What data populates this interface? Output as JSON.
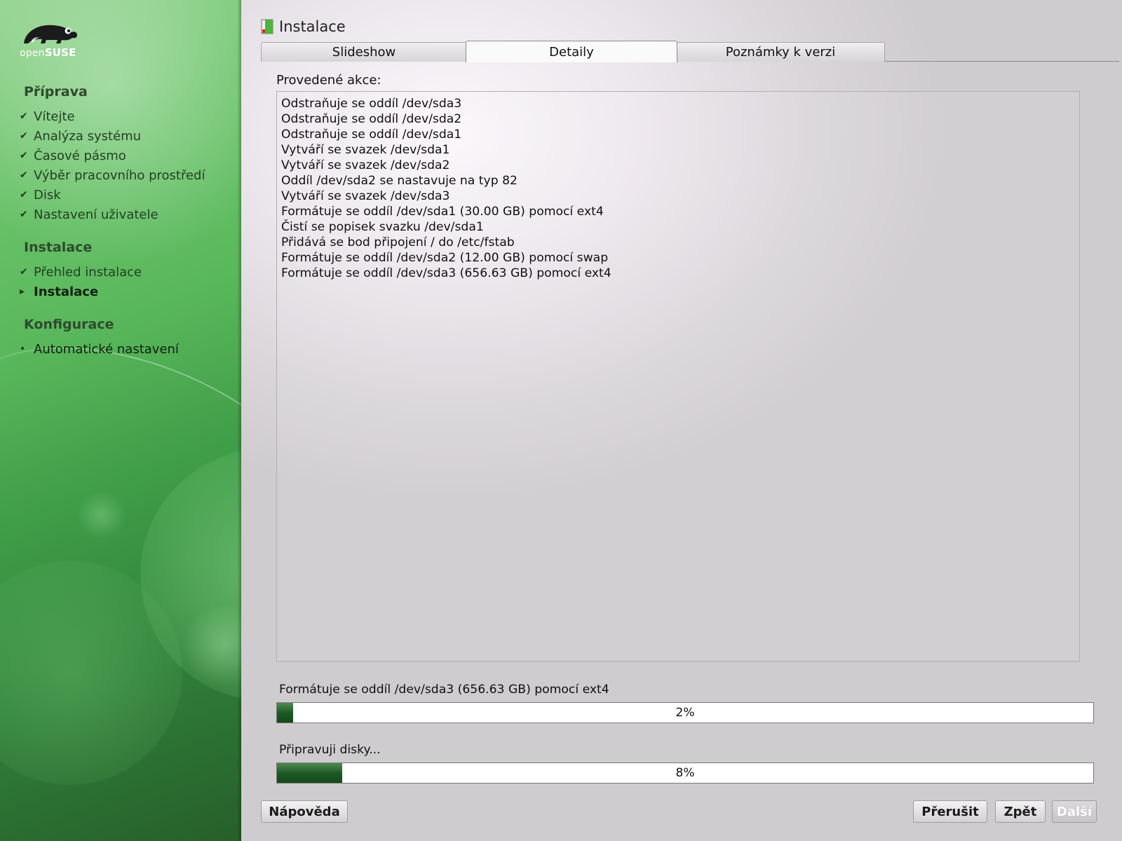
{
  "brand": {
    "logo_text_light": "open",
    "logo_text_bold": "SUSE",
    "accent": "#3f9c47"
  },
  "sidebar": {
    "sections": [
      {
        "heading": "Příprava",
        "items": [
          {
            "label": "Vítejte",
            "state": "done"
          },
          {
            "label": "Analýza systému",
            "state": "done"
          },
          {
            "label": "Časové pásmo",
            "state": "done"
          },
          {
            "label": "Výběr pracovního prostředí",
            "state": "done"
          },
          {
            "label": "Disk",
            "state": "done"
          },
          {
            "label": "Nastavení uživatele",
            "state": "done"
          }
        ]
      },
      {
        "heading": "Instalace",
        "items": [
          {
            "label": "Přehled instalace",
            "state": "done"
          },
          {
            "label": "Instalace",
            "state": "current"
          }
        ]
      },
      {
        "heading": "Konfigurace",
        "items": [
          {
            "label": "Automatické nastavení",
            "state": "pending"
          }
        ]
      }
    ]
  },
  "main": {
    "title": "Instalace",
    "tabs": [
      {
        "label": "Slideshow",
        "active": false
      },
      {
        "label": "Detaily",
        "active": true
      },
      {
        "label": "Poznámky k verzi",
        "active": false
      }
    ],
    "actions_label": "Provedené akce:",
    "log_lines": [
      "Odstraňuje se oddíl /dev/sda3",
      "Odstraňuje se oddíl /dev/sda2",
      "Odstraňuje se oddíl /dev/sda1",
      "Vytváří se svazek /dev/sda1",
      "Vytváří se svazek /dev/sda2",
      "Oddíl /dev/sda2 se nastavuje na typ 82",
      "Vytváří se svazek /dev/sda3",
      "Formátuje se oddíl /dev/sda1 (30.00 GB) pomocí ext4",
      "Čistí se popisek svazku /dev/sda1",
      "Přidává se bod připojení / do /etc/fstab",
      "Formátuje se oddíl /dev/sda2 (12.00 GB) pomocí swap",
      "Formátuje se oddíl /dev/sda3 (656.63 GB) pomocí ext4"
    ],
    "progress_current": {
      "label": "Formátuje se oddíl /dev/sda3 (656.63 GB) pomocí ext4",
      "percent": 2,
      "text": "2%"
    },
    "progress_total": {
      "label": "Připravuji disky...",
      "percent": 8,
      "text": "8%"
    }
  },
  "buttons": {
    "help": "Nápověda",
    "abort": "Přerušit",
    "back": "Zpět",
    "next": "Další"
  }
}
